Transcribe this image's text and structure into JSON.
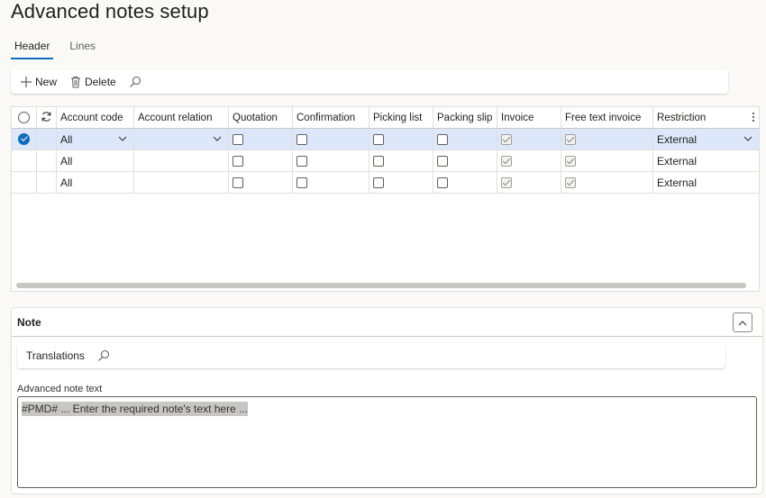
{
  "page": {
    "title": "Advanced notes setup"
  },
  "tabs": [
    {
      "label": "Header",
      "active": true
    },
    {
      "label": "Lines",
      "active": false
    }
  ],
  "toolbar": {
    "new_label": "New",
    "delete_label": "Delete",
    "new_icon": "plus-icon",
    "delete_icon": "trash-icon",
    "search_icon": "search-icon"
  },
  "grid": {
    "columns": [
      "Account code",
      "Account relation",
      "Quotation",
      "Confirmation",
      "Picking list",
      "Packing slip",
      "Invoice",
      "Free text invoice",
      "Restriction"
    ],
    "rows": [
      {
        "selected": true,
        "account_code": "All",
        "account_relation": "",
        "quotation": false,
        "confirmation": false,
        "picking_list": false,
        "packing_slip": false,
        "invoice": true,
        "free_text_invoice": true,
        "restriction": "External"
      },
      {
        "selected": false,
        "account_code": "All",
        "account_relation": "",
        "quotation": false,
        "confirmation": false,
        "picking_list": false,
        "packing_slip": false,
        "invoice": true,
        "free_text_invoice": true,
        "restriction": "External"
      },
      {
        "selected": false,
        "account_code": "All",
        "account_relation": "",
        "quotation": false,
        "confirmation": false,
        "picking_list": false,
        "packing_slip": false,
        "invoice": true,
        "free_text_invoice": true,
        "restriction": "External"
      }
    ]
  },
  "note": {
    "title": "Note",
    "translations_label": "Translations",
    "field_label": "Advanced note text",
    "text": "#PMD# ... Enter the required note's text here ..."
  },
  "colors": {
    "accent": "#0f6cbd",
    "selected_row": "#dce8fa"
  }
}
